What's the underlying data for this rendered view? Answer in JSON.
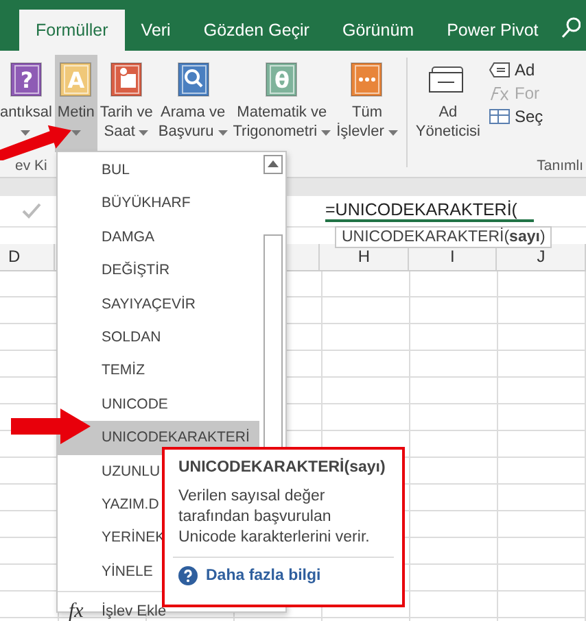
{
  "tabs": [
    {
      "label": "Formüller",
      "selected": true
    },
    {
      "label": "Veri",
      "selected": false
    },
    {
      "label": "Gözden Geçir",
      "selected": false
    },
    {
      "label": "Görünüm",
      "selected": false
    },
    {
      "label": "Power Pivot",
      "selected": false
    }
  ],
  "ribbon": {
    "buttons": [
      {
        "glyph": "?",
        "lines": [
          "antıksal"
        ],
        "dropdown": true,
        "selected": false
      },
      {
        "glyph": "A",
        "lines": [
          "Metin"
        ],
        "dropdown": true,
        "selected": true
      },
      {
        "lines": [
          "Tarih ve",
          "Saat"
        ],
        "dropdown": true,
        "selected": false
      },
      {
        "lines": [
          "Arama ve",
          "Başvuru"
        ],
        "dropdown": true,
        "selected": false
      },
      {
        "glyph": "θ",
        "lines": [
          "Matematik ve",
          "Trigonometri"
        ],
        "dropdown": true,
        "selected": false
      },
      {
        "lines": [
          "Tüm",
          "İşlevler"
        ],
        "dropdown": true,
        "selected": false
      },
      {
        "lines": [
          "Ad",
          "Yöneticisi"
        ],
        "dropdown": false,
        "selected": false
      }
    ],
    "small_items": [
      {
        "label": "Ad",
        "disabled": false
      },
      {
        "label": "For",
        "disabled": true
      },
      {
        "label": "Seç",
        "disabled": false
      }
    ],
    "group_labels": [
      "ev Ki",
      "Tanımlı"
    ]
  },
  "formula_bar": {
    "value": "=UNICODEKARAKTERİ(",
    "hint": "UNICODEKARAKTERİ(**sayı**)"
  },
  "columns": [
    "D",
    "H",
    "I",
    "J"
  ],
  "menu": {
    "items": [
      {
        "label": "BUL",
        "selected": false
      },
      {
        "label": "BÜYÜKHARF",
        "selected": false
      },
      {
        "label": "DAMGA",
        "selected": false
      },
      {
        "label": "DEĞİŞTİR",
        "selected": false
      },
      {
        "label": "SAYIYAÇEVİR",
        "selected": false
      },
      {
        "label": "SOLDAN",
        "selected": false
      },
      {
        "label": "TEMİZ",
        "selected": false
      },
      {
        "label": "UNICODE",
        "selected": false
      },
      {
        "label": "UNICODEKARAKTERİ",
        "selected": true
      },
      {
        "label": "UZUNLU",
        "selected": false
      },
      {
        "label": "YAZIM.D",
        "selected": false
      },
      {
        "label": "YERİNEK",
        "selected": false
      },
      {
        "label": "YİNELE",
        "selected": false
      }
    ],
    "footer": {
      "glyph": "fx",
      "label": "İşlev Ekle"
    }
  },
  "tooltip": {
    "title": "UNICODEKARAKTERİ(sayı)",
    "description": "Verilen sayısal değer tarafından başvurulan Unicode karakterlerini verir.",
    "link": "Daha fazla bilgi"
  }
}
